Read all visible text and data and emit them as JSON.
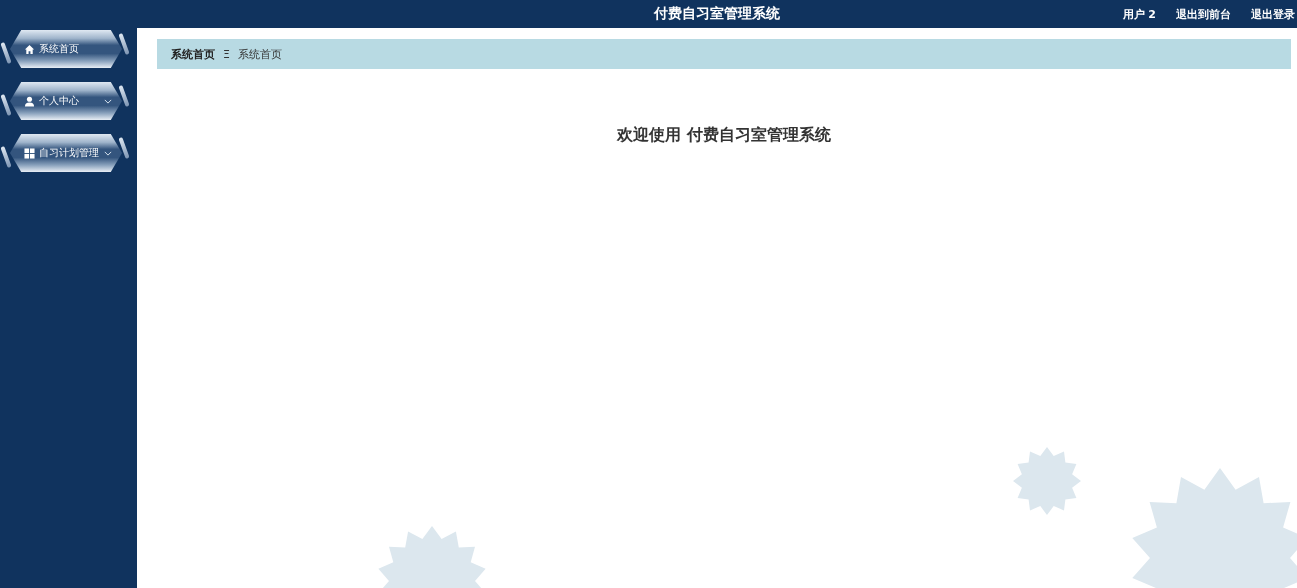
{
  "header": {
    "title": "付费自习室管理系统",
    "links": [
      "用户 2",
      "退出到前台",
      "退出登录"
    ]
  },
  "sidebar": {
    "items": [
      {
        "label": "系统首页",
        "kind": "home",
        "has_submenu": false
      },
      {
        "label": "个人中心",
        "kind": "user",
        "has_submenu": true
      },
      {
        "label": "自习计划管理",
        "kind": "grid",
        "has_submenu": true
      }
    ]
  },
  "breadcrumb": {
    "items": [
      "系统首页",
      "系统首页"
    ],
    "separator": "Ξ"
  },
  "welcome": "欢迎使用 付费自习室管理系统"
}
